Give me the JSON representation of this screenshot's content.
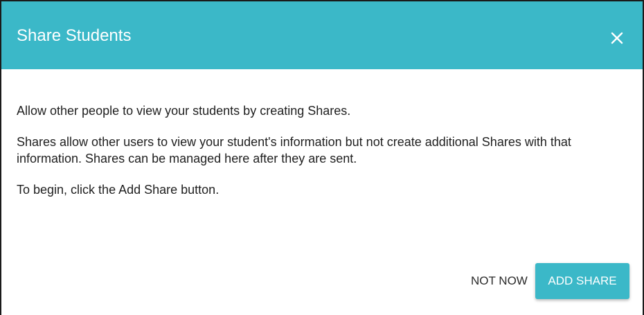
{
  "dialog": {
    "title": "Share Students",
    "close_icon": "close-icon",
    "paragraphs": [
      "Allow other people to view your students by creating Shares.",
      "Shares allow other users to view your student's information but not create additional Shares with that information. Shares can be managed here after they are sent.",
      "To begin, click the Add Share button."
    ],
    "actions": {
      "secondary_label": "NOT NOW",
      "primary_label": "ADD SHARE"
    }
  },
  "colors": {
    "accent": "#3bb8c8",
    "header_text": "#ffffff",
    "body_text": "#1f1f1f"
  }
}
